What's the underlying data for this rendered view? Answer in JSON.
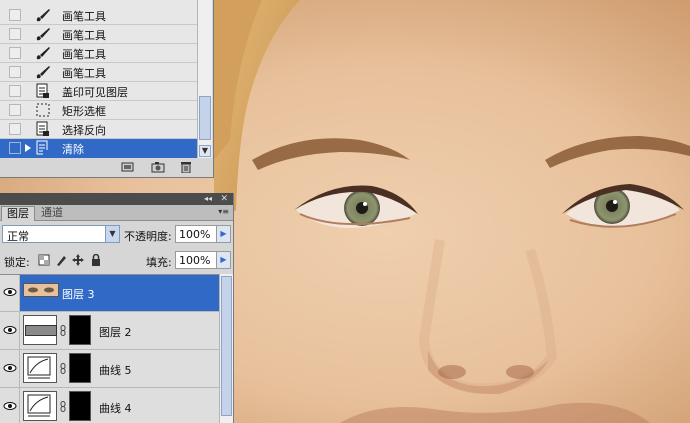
{
  "history": {
    "items": [
      {
        "label": "画笔工具",
        "icon": "brush-icon",
        "selected": false
      },
      {
        "label": "画笔工具",
        "icon": "brush-icon",
        "selected": false
      },
      {
        "label": "画笔工具",
        "icon": "brush-icon",
        "selected": false
      },
      {
        "label": "画笔工具",
        "icon": "brush-icon",
        "selected": false
      },
      {
        "label": "盖印可见图层",
        "icon": "document-icon",
        "selected": false
      },
      {
        "label": "矩形选框",
        "icon": "marquee-icon",
        "selected": false
      },
      {
        "label": "选择反向",
        "icon": "document-icon",
        "selected": false
      },
      {
        "label": "清除",
        "icon": "document-icon",
        "selected": true
      }
    ]
  },
  "layers": {
    "tabs": [
      "图层",
      "通道"
    ],
    "blend_mode": "正常",
    "opacity_label": "不透明度:",
    "opacity": "100%",
    "lock_label": "锁定:",
    "fill_label": "填充:",
    "fill": "100%",
    "rows": [
      {
        "name": "图层 3",
        "selected": true,
        "type": "image"
      },
      {
        "name": "图层 2",
        "selected": false,
        "type": "mask"
      },
      {
        "name": "曲线 5",
        "selected": false,
        "type": "curves"
      },
      {
        "name": "曲线 4",
        "selected": false,
        "type": "curves"
      }
    ]
  },
  "colors": {
    "selection": "#3169c6",
    "panel": "#d6d6d6",
    "skin": "#e3b98f"
  }
}
